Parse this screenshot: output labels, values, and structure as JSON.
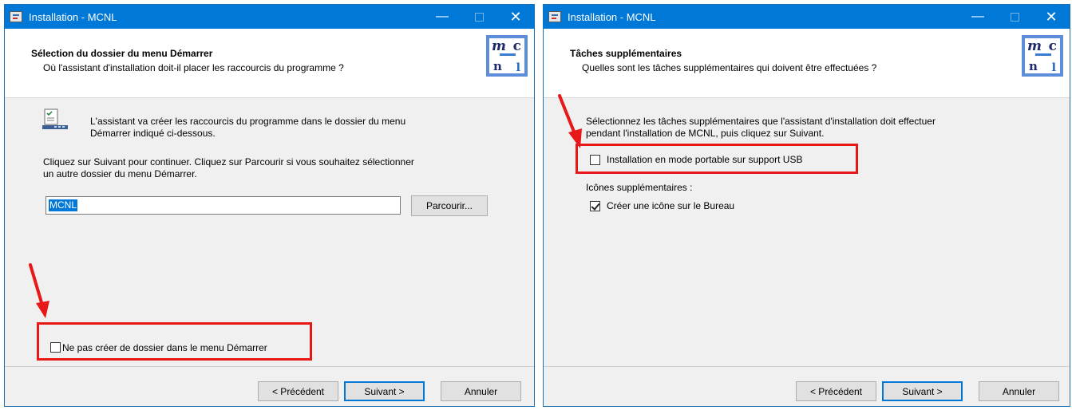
{
  "window_title": "Installation - MCNL",
  "titlebar": {
    "minimize": "—",
    "close": "✕"
  },
  "logo": {
    "m": "m",
    "c": "c",
    "n": "n",
    "l": "l"
  },
  "window1": {
    "heading": "Sélection du dossier du menu Démarrer",
    "subheading": "Où l'assistant d'installation doit-il placer les raccourcis du programme ?",
    "intro_line1": "L'assistant va créer les raccourcis du programme dans le dossier du menu",
    "intro_line2": "Démarrer indiqué ci-dessous.",
    "instruction_line1": "Cliquez sur Suivant pour continuer. Cliquez sur Parcourir si vous souhaitez sélectionner",
    "instruction_line2": "un autre dossier du menu Démarrer.",
    "folder_value": "MCNL",
    "browse_label": "Parcourir...",
    "no_folder_label": "Ne pas créer de dossier dans le menu Démarrer",
    "no_folder_checked": false,
    "buttons": {
      "back": "< Précédent",
      "next": "Suivant >",
      "cancel": "Annuler"
    }
  },
  "window2": {
    "heading": "Tâches supplémentaires",
    "subheading": "Quelles sont les tâches supplémentaires qui doivent être effectuées ?",
    "intro_line1": "Sélectionnez les tâches supplémentaires que l'assistant d'installation doit effectuer",
    "intro_line2": "pendant l'installation de MCNL, puis cliquez sur Suivant.",
    "portable_label": "Installation en mode portable sur support USB",
    "portable_checked": false,
    "icons_group_label": "Icônes supplémentaires :",
    "desktop_icon_label": "Créer une icône sur le Bureau",
    "desktop_icon_checked": true,
    "buttons": {
      "back": "< Précédent",
      "next": "Suivant >",
      "cancel": "Annuler"
    }
  },
  "colors": {
    "titlebar": "#0078d7",
    "highlight": "#e81818",
    "dialog_bg": "#f0f0f0"
  }
}
